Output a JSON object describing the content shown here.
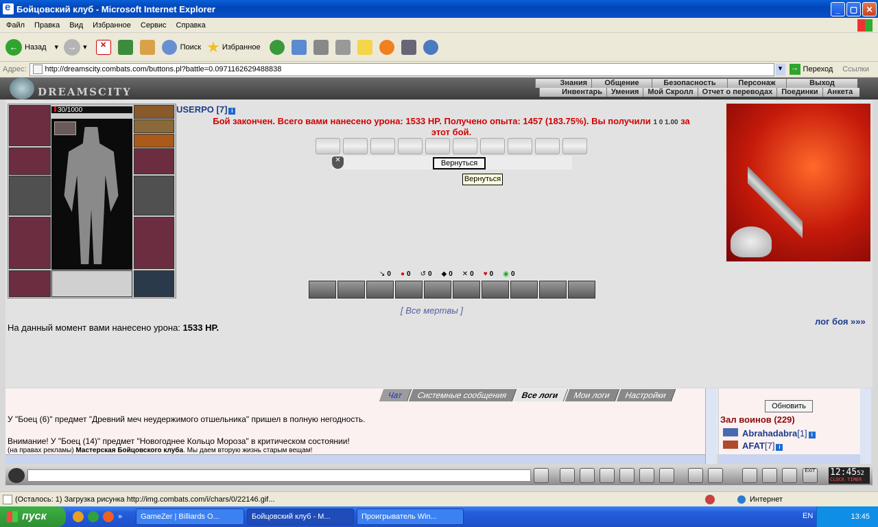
{
  "window": {
    "title": "Бойцовский клуб - Microsoft Internet Explorer"
  },
  "menu": [
    "Файл",
    "Правка",
    "Вид",
    "Избранное",
    "Сервис",
    "Справка"
  ],
  "toolbar": {
    "back": "Назад",
    "search": "Поиск",
    "favorites": "Избранное"
  },
  "address": {
    "label": "Адрес:",
    "url": "http://dreamscity.combats.com/buttons.pl?battle=0.0971162629488838",
    "go": "Переход",
    "links": "Ссылки"
  },
  "game": {
    "logo": "DREAMSCITY",
    "nav_top": [
      "Знания",
      "Общение",
      "Безопасность",
      "Персонаж",
      "Выход"
    ],
    "nav_bottom": [
      "Инвентарь",
      "Умения",
      "Мой Скролл",
      "Отчет о переводах",
      "Поединки",
      "Анкета"
    ],
    "hp": "30/1000",
    "username": "USERPO [7]",
    "battle_message_1": "Бой закончен. Всего вами нанесено урона: 1533 HP. Получено опыта: 1457 (183.75%). Вы получили",
    "reward_values": "1   0   1.00",
    "battle_message_suffix": "за",
    "battle_message_2": "этот бой.",
    "return_button": "Вернуться",
    "tooltip": "Вернуться",
    "counters": [
      "0",
      "0",
      "0",
      "0",
      "0",
      "0",
      "0"
    ],
    "all_dead": "[ Все мертвы ]",
    "log_link": "лог боя »»»",
    "damage_label": "На данный момент вами нанесено урона:",
    "damage_value": "1533 HP."
  },
  "chat": {
    "tabs": [
      "Чат",
      "Системные сообщения",
      "Все логи",
      "Мои логи",
      "Настройки"
    ],
    "lines": [
      "У \"Боец (6)\" предмет \"Древний меч неудержимого отшельника\" пришел в полную негодность.",
      "",
      "Внимание! У \"Боец (14)\" предмет \"Новогоднее Кольцо Мороза\" в критическом состоянии!"
    ],
    "ad_prefix": "(на правах рекламы)",
    "ad_bold": "Мастерская Бойцовского клуба",
    "ad_text": ". Мы даем вторую жизнь старым вещам!",
    "refresh": "Обновить",
    "hall": "Зал воинов (229)",
    "players": [
      {
        "name": "Abrahadabra",
        "level": "[1]"
      },
      {
        "name": "AFAT",
        "level": "[7]"
      }
    ],
    "clock": "12:45",
    "clock_seconds": "52",
    "clock_label": "CLOCK TIMER",
    "exit_label": "EXIT"
  },
  "status": {
    "text": "(Осталось: 1) Загрузка рисунка http://img.combats.com/i/chars/0/22146.gif...",
    "zone": "Интернет"
  },
  "taskbar": {
    "start": "пуск",
    "tasks": [
      "GameZer | Billiards O...",
      "Бойцовский клуб - M...",
      "Проигрыватель Win..."
    ],
    "lang": "EN",
    "time": "13:45"
  }
}
